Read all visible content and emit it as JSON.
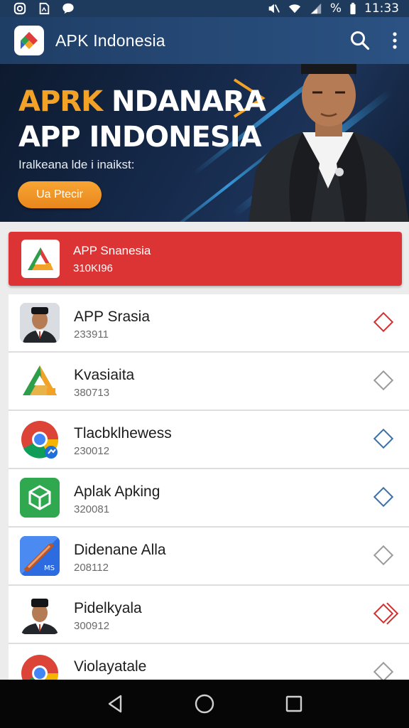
{
  "status_bar": {
    "time": "11:33",
    "battery": "%",
    "icons": [
      "instagram-icon",
      "document-icon",
      "chat-bubble-icon",
      "mute-icon",
      "wifi-icon",
      "signal-icon"
    ]
  },
  "app_bar": {
    "title": "APK Indonesia",
    "icons": [
      "app-logo-icon",
      "search-icon",
      "more-vert-icon"
    ]
  },
  "banner": {
    "headline_accent": "APRK",
    "headline_rest": "NDANARA",
    "headline_line2": "APP INDONESIA",
    "subtitle": "Iralkeana lde i inaikst:",
    "cta_label": "Ua Ptecir"
  },
  "featured": {
    "title": "APP Snanesia",
    "subtitle": "310KI96",
    "background": "#dc3434"
  },
  "apps": [
    {
      "title": "APP Srasia",
      "subtitle": "233911",
      "icon": "portrait-icon",
      "diamond_color": "#d32f2f"
    },
    {
      "title": "Kvasiaita",
      "subtitle": "380713",
      "icon": "triangle-logo-icon",
      "diamond_color": "#9a9a9a"
    },
    {
      "title": "Tlacbklhewess",
      "subtitle": "230012",
      "icon": "chrome-icon",
      "diamond_color": "#3a6fa8"
    },
    {
      "title": "Aplak Apking",
      "subtitle": "320081",
      "icon": "green-cube-icon",
      "diamond_color": "#3a6fa8"
    },
    {
      "title": "Didenane Alla",
      "subtitle": "208112",
      "icon": "blue-scroll-icon",
      "diamond_color": "#9a9a9a"
    },
    {
      "title": "Pidelkyala",
      "subtitle": "300912",
      "icon": "portrait-icon",
      "diamond_color": "#d32f2f"
    },
    {
      "title": "Violayatale",
      "subtitle": "",
      "icon": "chrome-icon",
      "diamond_color": "#9a9a9a"
    }
  ],
  "nav_bar": {
    "icons": [
      "back-icon",
      "home-icon",
      "recents-icon"
    ]
  }
}
